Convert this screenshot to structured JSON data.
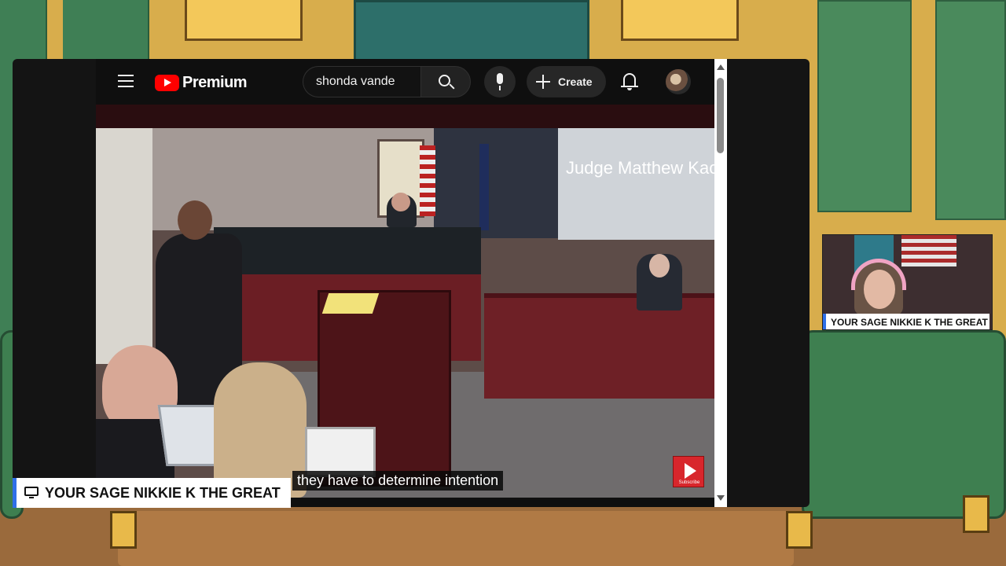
{
  "youtube": {
    "logo_text": "Premium",
    "search_value": "shonda vande",
    "create_label": "Create"
  },
  "video": {
    "screen_text": "Judge Matthew Kacel",
    "subtitle": "they have to determine intention",
    "subscribe_label": "Subscribe"
  },
  "overlay": {
    "nameplate": "YOUR SAGE NIKKIE K THE GREAT",
    "cam_label": "YOUR SAGE NIKKIE K THE GREAT"
  },
  "colors": {
    "youtube_red": "#ff0000",
    "overlay_accent": "#2f6fe8",
    "youtube_bg": "#0f0f0f"
  },
  "icons": [
    "menu-icon",
    "youtube-logo-icon",
    "search-icon",
    "mic-icon",
    "plus-icon",
    "bell-icon",
    "monitor-icon",
    "play-icon"
  ]
}
